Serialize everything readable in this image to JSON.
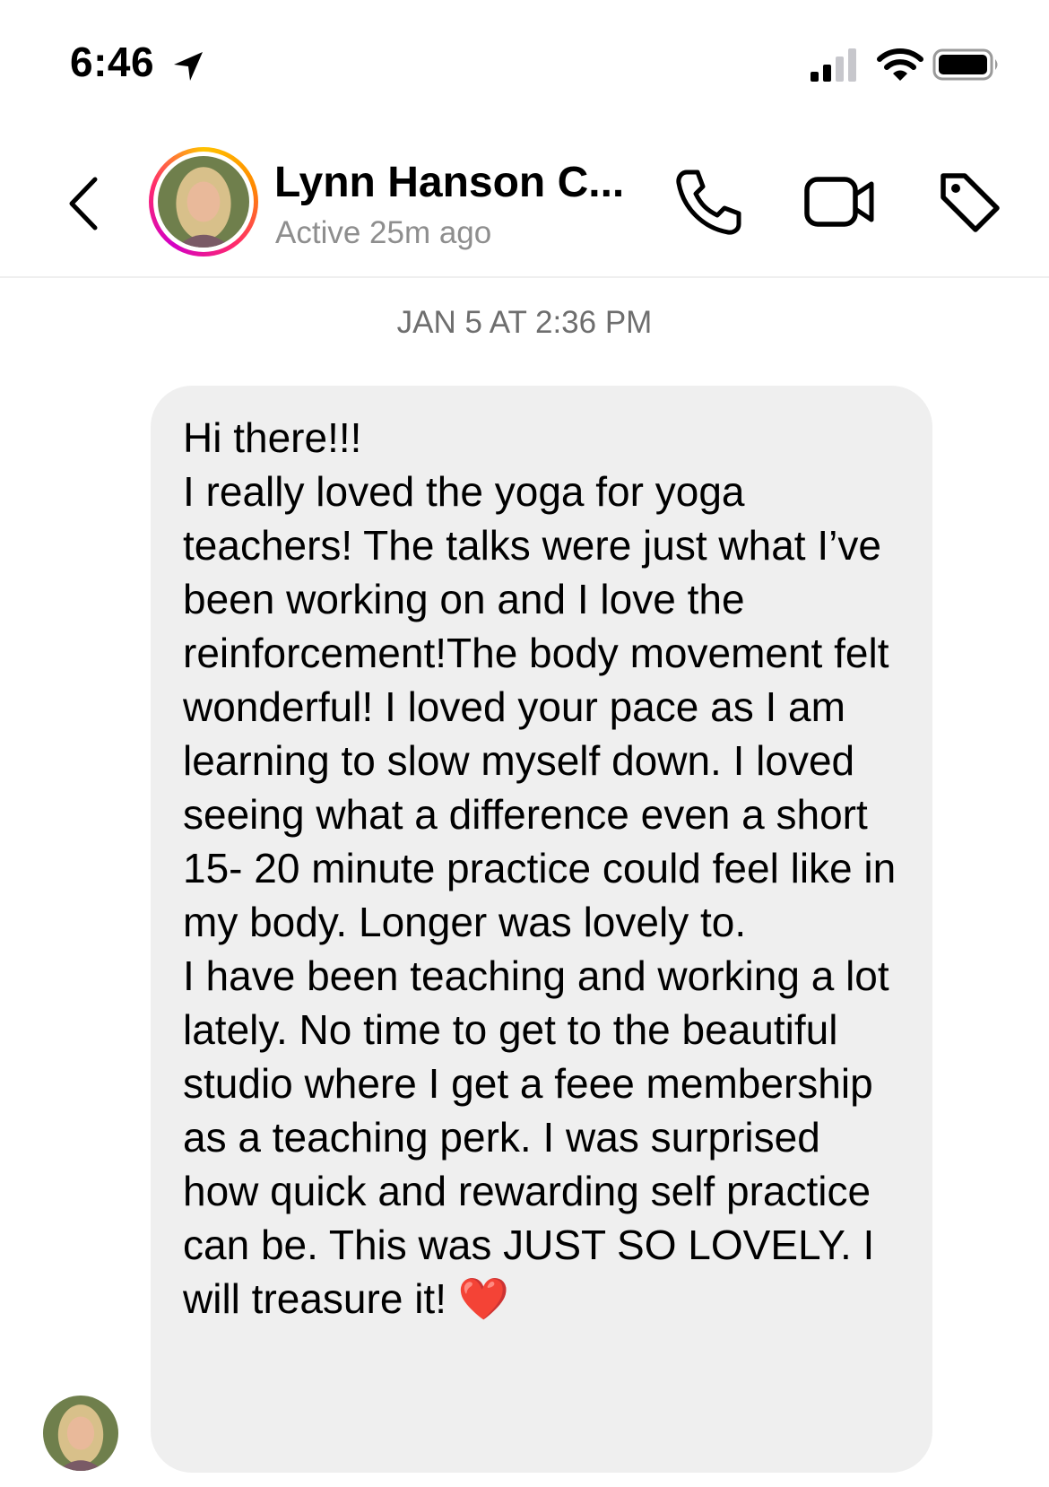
{
  "status_bar": {
    "time": "6:46",
    "icons": [
      "location-arrow-icon",
      "cellular-signal-icon",
      "wifi-icon",
      "battery-icon"
    ]
  },
  "header": {
    "contact_name": "Lynn Hanson C...",
    "active_status": "Active 25m ago",
    "icons": [
      "back-chevron-icon",
      "phone-call-icon",
      "video-camera-icon",
      "tag-icon"
    ]
  },
  "thread": {
    "timestamp": "JAN 5 AT 2:36 PM",
    "message": {
      "text": "Hi there!!!\nI really loved the yoga for yoga teachers! The talks were just what I’ve been working on and I love the reinforcement!The body movement felt wonderful! I loved your pace as I am learning to slow myself down. I loved seeing what a difference even a short 15- 20 minute practice could feel like in my body. Longer was lovely to.\nI have been teaching and working a lot lately. No time to get to the beautiful studio where I get a feee membership as a teaching perk. I was surprised how quick and rewarding self practice can be. This was JUST SO LOVELY. I will treasure it! ",
      "emoji": "❤️"
    }
  },
  "colors": {
    "bubble_background": "#efefef",
    "secondary_text": "#8e8e8e",
    "heart": "#ea1b2a"
  }
}
